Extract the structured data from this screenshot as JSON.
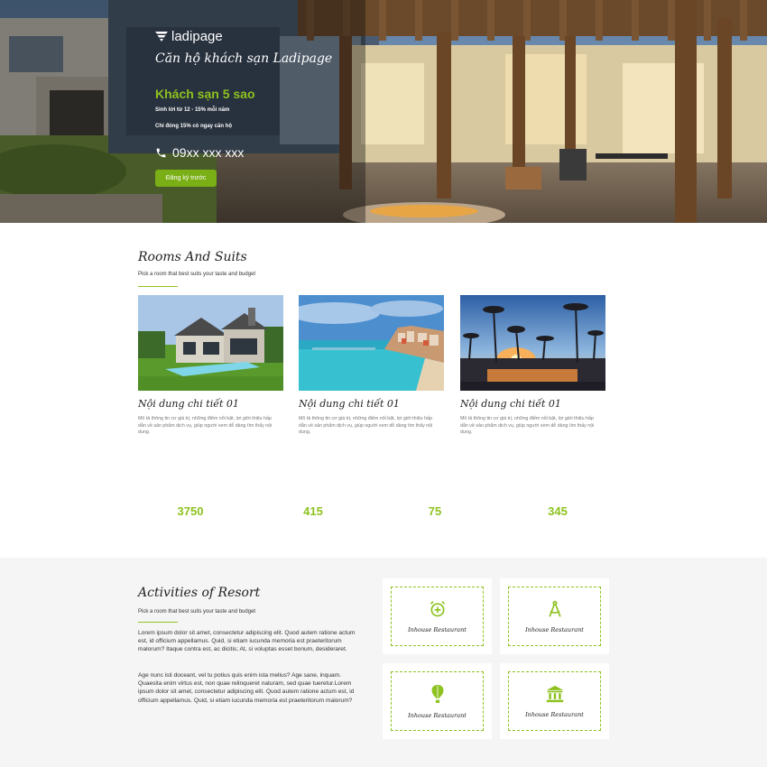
{
  "hero": {
    "logo_text": "ladipage",
    "subtitle": "Căn hộ khách sạn Ladipage",
    "title": "Khách sạn 5 sao",
    "line1": "Sinh lời từ 12 - 15% mỗi năm",
    "line2": "Chỉ đóng 15% có ngay căn hộ",
    "phone": "09xx xxx xxx",
    "cta_label": "Đăng ký trước"
  },
  "rooms": {
    "title": "Rooms And Suits",
    "subtitle": "Pick a room that best suits your taste and budget",
    "items": [
      {
        "title": "Nội dung chi tiết 01",
        "desc": "Mô tả thông tin cơ giá trị, những điểm nổi bật, lợi giới thiệu hấp dẫn về sản phẩm dịch vụ, giúp người xem dễ dàng tìm thấy nội dung."
      },
      {
        "title": "Nội dung chi tiết 01",
        "desc": "Mô tả thông tin cơ giá trị, những điểm nổi bật, lợi giới thiệu hấp dẫn về sản phẩm dịch vụ, giúp người xem dễ dàng tìm thấy nội dung."
      },
      {
        "title": "Nội dung chi tiết 01",
        "desc": "Mô tả thông tin cơ giá trị, những điểm nổi bật, lợi giới thiệu hấp dẫn về sản phẩm dịch vụ, giúp người xem dễ dàng tìm thấy nội dung."
      }
    ]
  },
  "stats": [
    "3750",
    "415",
    "75",
    "345"
  ],
  "activities": {
    "title": "Activities of Resort",
    "subtitle": "Pick a room that best suits your taste and budget",
    "para1": "Lorem ipsum dolor sit amet, consectetur adipiscing elit. Quod autem ratione actum est, id officium appellamus. Quid, si etiam iucunda memoria est praeteritorum malorum? Itaque contra est, ac dicitis; At, si voluptas esset bonum, desideraret.",
    "para2": "Age nunc isti doceant, vel tu potius quis enim ista melius? Age sane, inquam. Quaesita enim virtus est, non quae relinqueret naturam, sed quae tueretur.Lorem ipsum dolor sit amet, consectetur adipiscing elit. Quod autem ratione actum est, id officium appellamus. Quid, si etiam iucunda memoria est praeteritorum malorum?",
    "features": [
      {
        "icon": "alarm-clock-add-icon",
        "label": "Inhouse Restaurant"
      },
      {
        "icon": "compass-drafting-icon",
        "label": "Inhouse Restaurant"
      },
      {
        "icon": "hot-air-balloon-icon",
        "label": "Inhouse Restaurant"
      },
      {
        "icon": "bank-building-icon",
        "label": "Inhouse Restaurant"
      }
    ]
  },
  "colors": {
    "accent": "#8dc21f",
    "cta": "#7aaf16",
    "section_bg": "#f5f5f5"
  }
}
